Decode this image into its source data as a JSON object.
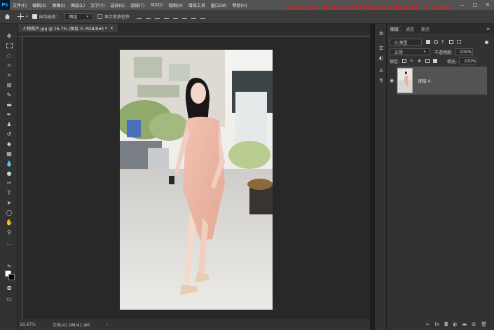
{
  "app": {
    "logo": "Ps"
  },
  "menu": {
    "items": [
      "文件(F)",
      "编辑(E)",
      "图像(I)",
      "图层(L)",
      "文字(Y)",
      "选择(S)",
      "滤镜(T)",
      "3D(D)",
      "视图(V)",
      "增效工具",
      "窗口(W)",
      "帮助(H)"
    ]
  },
  "window_controls": {
    "minimize": "—",
    "maximize": "□",
    "close": "✕"
  },
  "watermark": "www.haoyidiansheji.com",
  "options": {
    "auto_select_label": "自动选择：",
    "auto_select_value": "图层",
    "show_transform_label": "显示变换控件"
  },
  "document": {
    "tab_title": "人物照片.jpg @ 16.7% (图层 0, RGB/8#) *",
    "tab_close": "×"
  },
  "status": {
    "zoom": "16.67%",
    "doc_size": "文档:41.9M/41.9M",
    "arrow": "›"
  },
  "panel": {
    "tabs": [
      "图层",
      "通道",
      "路径"
    ],
    "active_tab": "图层",
    "menu_icon": "≡",
    "filter_kind": "Q 类型",
    "blend_mode": "正常",
    "opacity_label": "不透明度:",
    "opacity_value": "100%",
    "lock_label": "锁定:",
    "fill_label": "填充:",
    "fill_value": "100%",
    "layers": [
      {
        "name": "图层 0",
        "visible": true
      }
    ]
  },
  "icons": {
    "eye": "eye-icon"
  },
  "colors": {
    "accent": "#31a8ff",
    "watermark": "#e0211c",
    "panel_bg": "#323232",
    "canvas_bg": "#282828"
  }
}
